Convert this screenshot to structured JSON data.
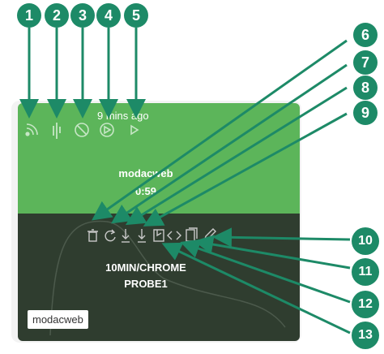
{
  "card": {
    "time_ago": "9 mins ago",
    "title": "modacweb",
    "duration": "0:59",
    "recording_name_line1": "10MIN/CHROME",
    "recording_name_line2": "PROBE1",
    "tag": "modacweb"
  },
  "stat_icons": [
    "rss-icon",
    "waveform-icon",
    "blocked-icon",
    "play-circle-icon",
    "play-icon"
  ],
  "action_icons": [
    "trash-icon",
    "refresh-icon",
    "download-icon",
    "download-alt-icon",
    "save-icon",
    "code-icon",
    "copy-icon",
    "pencil-icon"
  ],
  "callouts": [
    "1",
    "2",
    "3",
    "4",
    "5",
    "6",
    "7",
    "8",
    "9",
    "10",
    "11",
    "12",
    "13"
  ],
  "colors": {
    "callout": "#1d8a67",
    "card_top": "#5cb55a",
    "card_bottom": "#2f3d2f"
  }
}
